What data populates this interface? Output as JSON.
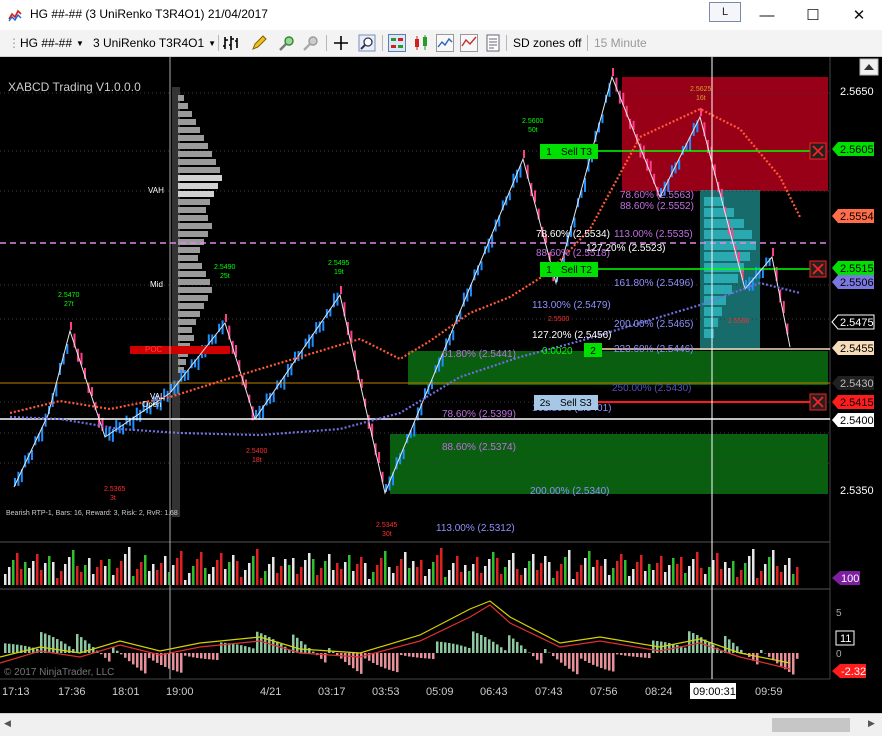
{
  "window": {
    "title": "HG ##-## (3 UniRenko T3R4O1)  21/04/2017",
    "link_label": "L",
    "minimize": "—",
    "maximize": "☐",
    "close": "✕"
  },
  "toolbar": {
    "instrument": "HG ##-##",
    "bar_type": "3 UniRenko T3R4O1",
    "sd_zones": "SD zones off",
    "timeframe": "15 Minute"
  },
  "chart": {
    "indicator_title": "XABCD Trading V1.0.0.0",
    "copyright": "© 2017 NinjaTrader, LLC",
    "bearish_info": "Bearish RTP-1, Bars: 16, Reward: 3, Risk: 2, RvR: 1.68",
    "profile_labels": {
      "vah": "VAH",
      "mid": "Mid",
      "val": "VAL",
      "poc": "POC",
      "open": "Open"
    },
    "price_axis": [
      "2.5650",
      "2.5350",
      "2.5400"
    ],
    "price_tags": [
      {
        "text": "2.5605",
        "bg": "#00e000",
        "fg": "#000000"
      },
      {
        "text": "2.5554",
        "bg": "#ff6d4a",
        "fg": "#000000"
      },
      {
        "text": "2.5515",
        "bg": "#00e000",
        "fg": "#000000"
      },
      {
        "text": "2.5506",
        "bg": "#7a78e0",
        "fg": "#000000"
      },
      {
        "text": "2.5475",
        "bg": "#000000",
        "fg": "#ffffff"
      },
      {
        "text": "2.5455",
        "bg": "#f6dcb8",
        "fg": "#000000"
      },
      {
        "text": "2.5430",
        "bg": "#202020",
        "fg": "#bbbbbb"
      },
      {
        "text": "2.5415",
        "bg": "#ff1c1c",
        "fg": "#000000"
      },
      {
        "text": "2.5400",
        "bg": "#ffffff",
        "fg": "#000000"
      }
    ],
    "orders": [
      {
        "qty": "1",
        "label": "Sell T3"
      },
      {
        "qty": "1",
        "label": "Sell T2"
      },
      {
        "qty": "2",
        "label": "0.0020"
      },
      {
        "qty": "2s",
        "label": "Sell S3"
      }
    ],
    "fib_labels": [
      "78.60% (2.5534)",
      "88.60% (2.5518)",
      "127.20% (2.5523)",
      "113.00% (2.5535)",
      "78.60% (2.5563)",
      "88.60% (2.5552)",
      "161.80% (2.5496)",
      "113.00% (2.5479)",
      "127.20% (2.5456)",
      "200.00% (2.5465)",
      "223.60% (2.5446)",
      "61.80% (2.5441)",
      "78.60% (2.5399)",
      "161.80% (2.5401)",
      "88.60% (2.5374)",
      "200.00% (2.5340)",
      "113.00% (2.5312)",
      "250.00% (2.5430)"
    ],
    "swing_labels": [
      {
        "price": "2.5470",
        "ticks": "27t"
      },
      {
        "price": "2.5490",
        "ticks": "25t"
      },
      {
        "price": "2.5495",
        "ticks": "19t"
      },
      {
        "price": "2.5600",
        "ticks": "50t"
      },
      {
        "price": "2.5625",
        "ticks": "16t"
      },
      {
        "price": "2.5365",
        "ticks": "3t"
      },
      {
        "price": "2.5400",
        "ticks": "18t"
      },
      {
        "price": "2.5345",
        "ticks": "30t"
      },
      {
        "price": "2.5500",
        "ticks": ""
      },
      {
        "price": "2.5500",
        "ticks": ""
      }
    ],
    "volume_tag": "100",
    "osc_axis": [
      "5",
      "0",
      "-5"
    ],
    "osc_tag_upper": "11",
    "osc_tag_lower": "-2.32",
    "time_axis": [
      "17:13",
      "17:36",
      "18:01",
      "19:00",
      "4/21",
      "03:17",
      "03:53",
      "05:09",
      "06:43",
      "07:43",
      "07:56",
      "08:24",
      "09:00:31",
      "09:59"
    ],
    "colors": {
      "up_candle": "#1e90ff",
      "down_candle": "#ff3d8b",
      "supply_zone": "#b3001b",
      "demand_zone": "#0a6e12",
      "teal_zone": "#1f8f8f",
      "buy_line": "#00ff00",
      "sell_line": "#ff1a1a"
    }
  }
}
